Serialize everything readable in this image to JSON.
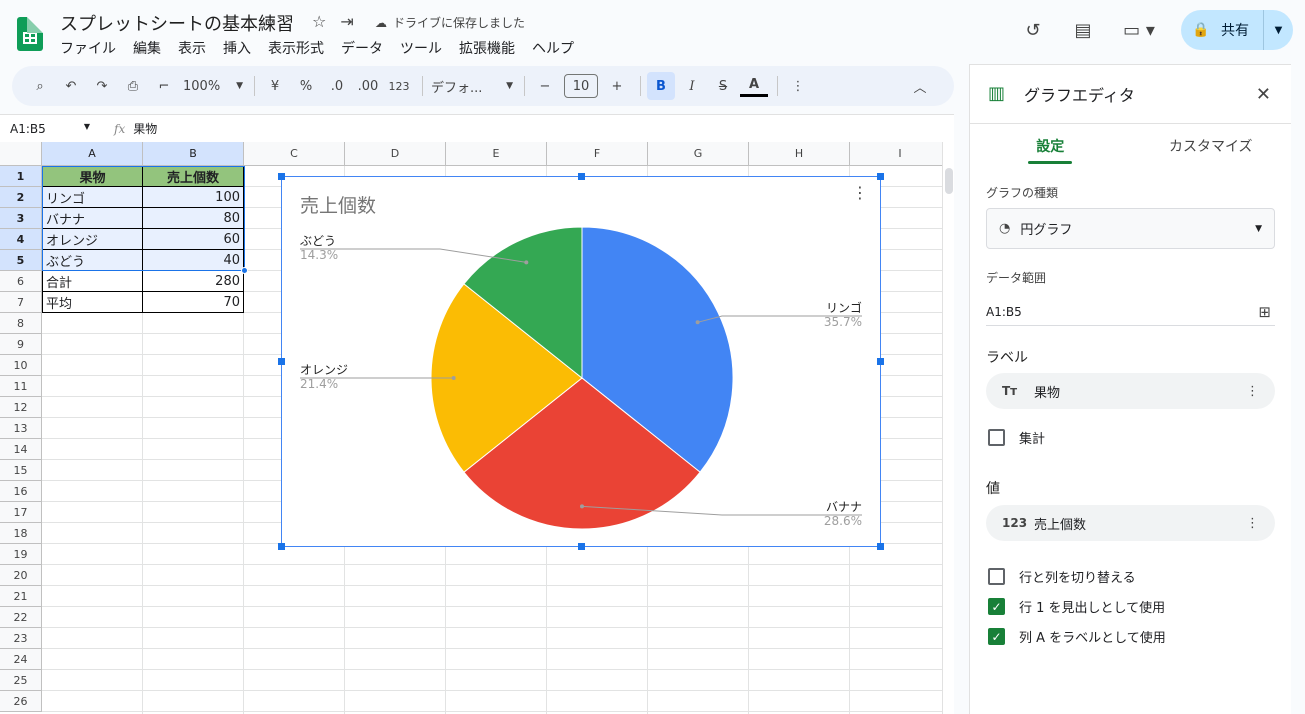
{
  "app": {
    "doc_title": "スプレットシートの基本練習",
    "saved_status": "ドライブに保存しました",
    "share_label": "共有",
    "menu": [
      "ファイル",
      "編集",
      "表示",
      "挿入",
      "表示形式",
      "データ",
      "ツール",
      "拡張機能",
      "ヘルプ"
    ]
  },
  "toolbar": {
    "zoom": "100%",
    "currency": "¥",
    "percent": "%",
    "dec_decrease": ".0",
    "dec_increase": ".00",
    "number_format": "123",
    "font": "デフォ...",
    "font_size": "10",
    "bold": "B",
    "italic": "I",
    "strike": "S",
    "text_color": "A"
  },
  "formula_bar": {
    "name_box": "A1:B5",
    "fx": "fx",
    "content": "果物"
  },
  "sheet": {
    "columns": [
      "A",
      "B",
      "C",
      "D",
      "E",
      "F",
      "G",
      "H",
      "I"
    ],
    "rows": [
      "1",
      "2",
      "3",
      "4",
      "5",
      "6",
      "7",
      "8",
      "9",
      "10",
      "11",
      "12",
      "13",
      "14",
      "15",
      "16",
      "17",
      "18",
      "19",
      "20",
      "21",
      "22",
      "23",
      "24",
      "25",
      "26"
    ],
    "header": [
      "果物",
      "売上個数"
    ],
    "data": [
      [
        "リンゴ",
        "100"
      ],
      [
        "バナナ",
        "80"
      ],
      [
        "オレンジ",
        "60"
      ],
      [
        "ぶどう",
        "40"
      ],
      [
        "合計",
        "280"
      ],
      [
        "平均",
        "70"
      ]
    ]
  },
  "chart_data": {
    "type": "pie",
    "title": "売上個数",
    "categories": [
      "リンゴ",
      "バナナ",
      "オレンジ",
      "ぶどう"
    ],
    "values": [
      100,
      80,
      60,
      40
    ],
    "percent_labels": [
      "35.7%",
      "28.6%",
      "21.4%",
      "14.3%"
    ],
    "colors": [
      "#4285f4",
      "#ea4335",
      "#fbbc04",
      "#34a853"
    ]
  },
  "editor": {
    "title": "グラフエディタ",
    "tabs": [
      "設定",
      "カスタマイズ"
    ],
    "chart_type_label": "グラフの種類",
    "chart_type": "円グラフ",
    "range_label": "データ範囲",
    "range": "A1:B5",
    "label_section": "ラベル",
    "label_field": "果物",
    "aggregate": "集計",
    "value_section": "値",
    "value_field": "売上個数",
    "value_icon": "123",
    "label_icon": "Tт",
    "switch_rows_cols": "行と列を切り替える",
    "use_row_header": "行 1 を見出しとして使用",
    "use_col_labels": "列 A をラベルとして使用"
  }
}
